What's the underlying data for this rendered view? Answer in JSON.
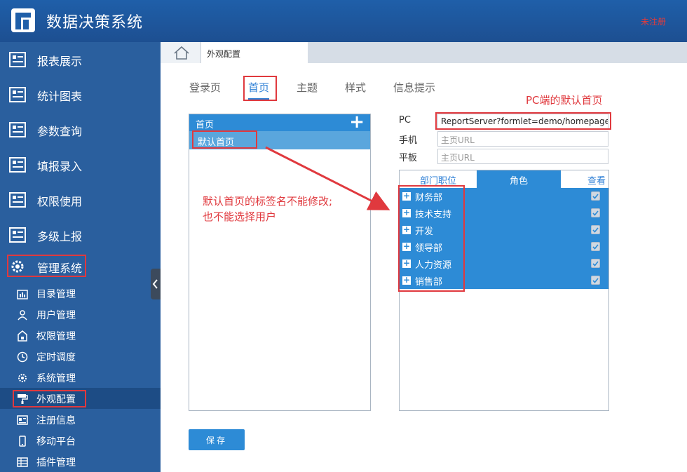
{
  "header": {
    "title": "数据决策系统",
    "unregistered": "未注册"
  },
  "sidebar": {
    "items": [
      {
        "label": "报表展示"
      },
      {
        "label": "统计图表"
      },
      {
        "label": "参数查询"
      },
      {
        "label": "填报录入"
      },
      {
        "label": "权限使用"
      },
      {
        "label": "多级上报"
      },
      {
        "label": "管理系统"
      }
    ],
    "sub_items": [
      {
        "label": "目录管理",
        "icon": "catalog-icon"
      },
      {
        "label": "用户管理",
        "icon": "user-icon"
      },
      {
        "label": "权限管理",
        "icon": "lock-icon"
      },
      {
        "label": "定时调度",
        "icon": "clock-icon"
      },
      {
        "label": "系统管理",
        "icon": "gear-icon"
      },
      {
        "label": "外观配置",
        "icon": "paint-roller-icon"
      },
      {
        "label": "注册信息",
        "icon": "register-icon"
      },
      {
        "label": "移动平台",
        "icon": "mobile-icon"
      },
      {
        "label": "插件管理",
        "icon": "plugin-icon"
      }
    ]
  },
  "main": {
    "page_tab": "外观配置",
    "subtabs": [
      "登录页",
      "首页",
      "主题",
      "样式",
      "信息提示"
    ],
    "pc_note": "PC端的默认首页",
    "list": {
      "header": "首页",
      "add_glyph": "+",
      "default_row": "默认首页"
    },
    "annotation": [
      "默认首页的标签名不能修改;",
      "也不能选择用户"
    ],
    "fields": {
      "pc_label": "PC",
      "pc_value": "ReportServer?formlet=demo/homepage/...",
      "mobile_label": "手机",
      "mobile_placeholder": "主页URL",
      "tablet_label": "平板",
      "tablet_placeholder": "主页URL"
    },
    "role_tabs": [
      "部门职位",
      "角色",
      "查看"
    ],
    "departments": [
      "财务部",
      "技术支持",
      "开发",
      "领导部",
      "人力资源",
      "销售部"
    ],
    "save_label": "保存"
  },
  "colors": {
    "header": "#1f5fa9",
    "sidebar": "#2a5f9e",
    "accent": "#2d8bd6",
    "annotation": "#e0393e"
  }
}
